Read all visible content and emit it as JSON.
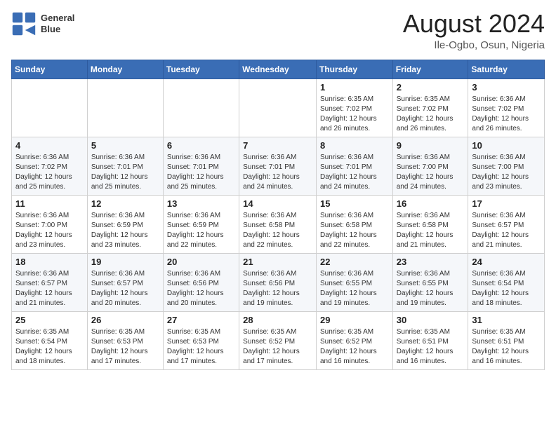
{
  "header": {
    "logo_line1": "General",
    "logo_line2": "Blue",
    "month": "August 2024",
    "location": "Ile-Ogbo, Osun, Nigeria"
  },
  "days_of_week": [
    "Sunday",
    "Monday",
    "Tuesday",
    "Wednesday",
    "Thursday",
    "Friday",
    "Saturday"
  ],
  "weeks": [
    [
      {
        "day": "",
        "info": ""
      },
      {
        "day": "",
        "info": ""
      },
      {
        "day": "",
        "info": ""
      },
      {
        "day": "",
        "info": ""
      },
      {
        "day": "1",
        "info": "Sunrise: 6:35 AM\nSunset: 7:02 PM\nDaylight: 12 hours\nand 26 minutes."
      },
      {
        "day": "2",
        "info": "Sunrise: 6:35 AM\nSunset: 7:02 PM\nDaylight: 12 hours\nand 26 minutes."
      },
      {
        "day": "3",
        "info": "Sunrise: 6:36 AM\nSunset: 7:02 PM\nDaylight: 12 hours\nand 26 minutes."
      }
    ],
    [
      {
        "day": "4",
        "info": "Sunrise: 6:36 AM\nSunset: 7:02 PM\nDaylight: 12 hours\nand 25 minutes."
      },
      {
        "day": "5",
        "info": "Sunrise: 6:36 AM\nSunset: 7:01 PM\nDaylight: 12 hours\nand 25 minutes."
      },
      {
        "day": "6",
        "info": "Sunrise: 6:36 AM\nSunset: 7:01 PM\nDaylight: 12 hours\nand 25 minutes."
      },
      {
        "day": "7",
        "info": "Sunrise: 6:36 AM\nSunset: 7:01 PM\nDaylight: 12 hours\nand 24 minutes."
      },
      {
        "day": "8",
        "info": "Sunrise: 6:36 AM\nSunset: 7:01 PM\nDaylight: 12 hours\nand 24 minutes."
      },
      {
        "day": "9",
        "info": "Sunrise: 6:36 AM\nSunset: 7:00 PM\nDaylight: 12 hours\nand 24 minutes."
      },
      {
        "day": "10",
        "info": "Sunrise: 6:36 AM\nSunset: 7:00 PM\nDaylight: 12 hours\nand 23 minutes."
      }
    ],
    [
      {
        "day": "11",
        "info": "Sunrise: 6:36 AM\nSunset: 7:00 PM\nDaylight: 12 hours\nand 23 minutes."
      },
      {
        "day": "12",
        "info": "Sunrise: 6:36 AM\nSunset: 6:59 PM\nDaylight: 12 hours\nand 23 minutes."
      },
      {
        "day": "13",
        "info": "Sunrise: 6:36 AM\nSunset: 6:59 PM\nDaylight: 12 hours\nand 22 minutes."
      },
      {
        "day": "14",
        "info": "Sunrise: 6:36 AM\nSunset: 6:58 PM\nDaylight: 12 hours\nand 22 minutes."
      },
      {
        "day": "15",
        "info": "Sunrise: 6:36 AM\nSunset: 6:58 PM\nDaylight: 12 hours\nand 22 minutes."
      },
      {
        "day": "16",
        "info": "Sunrise: 6:36 AM\nSunset: 6:58 PM\nDaylight: 12 hours\nand 21 minutes."
      },
      {
        "day": "17",
        "info": "Sunrise: 6:36 AM\nSunset: 6:57 PM\nDaylight: 12 hours\nand 21 minutes."
      }
    ],
    [
      {
        "day": "18",
        "info": "Sunrise: 6:36 AM\nSunset: 6:57 PM\nDaylight: 12 hours\nand 21 minutes."
      },
      {
        "day": "19",
        "info": "Sunrise: 6:36 AM\nSunset: 6:57 PM\nDaylight: 12 hours\nand 20 minutes."
      },
      {
        "day": "20",
        "info": "Sunrise: 6:36 AM\nSunset: 6:56 PM\nDaylight: 12 hours\nand 20 minutes."
      },
      {
        "day": "21",
        "info": "Sunrise: 6:36 AM\nSunset: 6:56 PM\nDaylight: 12 hours\nand 19 minutes."
      },
      {
        "day": "22",
        "info": "Sunrise: 6:36 AM\nSunset: 6:55 PM\nDaylight: 12 hours\nand 19 minutes."
      },
      {
        "day": "23",
        "info": "Sunrise: 6:36 AM\nSunset: 6:55 PM\nDaylight: 12 hours\nand 19 minutes."
      },
      {
        "day": "24",
        "info": "Sunrise: 6:36 AM\nSunset: 6:54 PM\nDaylight: 12 hours\nand 18 minutes."
      }
    ],
    [
      {
        "day": "25",
        "info": "Sunrise: 6:35 AM\nSunset: 6:54 PM\nDaylight: 12 hours\nand 18 minutes."
      },
      {
        "day": "26",
        "info": "Sunrise: 6:35 AM\nSunset: 6:53 PM\nDaylight: 12 hours\nand 17 minutes."
      },
      {
        "day": "27",
        "info": "Sunrise: 6:35 AM\nSunset: 6:53 PM\nDaylight: 12 hours\nand 17 minutes."
      },
      {
        "day": "28",
        "info": "Sunrise: 6:35 AM\nSunset: 6:52 PM\nDaylight: 12 hours\nand 17 minutes."
      },
      {
        "day": "29",
        "info": "Sunrise: 6:35 AM\nSunset: 6:52 PM\nDaylight: 12 hours\nand 16 minutes."
      },
      {
        "day": "30",
        "info": "Sunrise: 6:35 AM\nSunset: 6:51 PM\nDaylight: 12 hours\nand 16 minutes."
      },
      {
        "day": "31",
        "info": "Sunrise: 6:35 AM\nSunset: 6:51 PM\nDaylight: 12 hours\nand 16 minutes."
      }
    ]
  ]
}
